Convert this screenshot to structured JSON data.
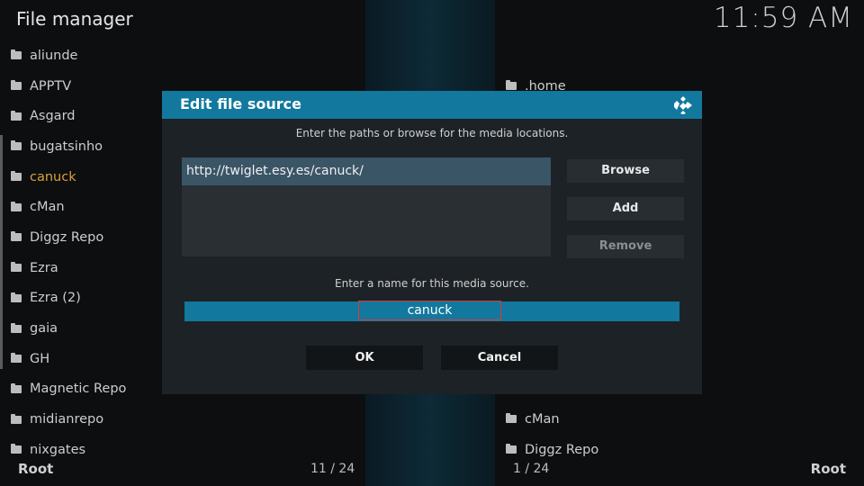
{
  "header": {
    "title": "File manager",
    "clock": "11:59 AM"
  },
  "left_list": [
    {
      "label": "aliunde"
    },
    {
      "label": "APPTV"
    },
    {
      "label": "Asgard"
    },
    {
      "label": "bugatsinho"
    },
    {
      "label": "canuck",
      "selected": true
    },
    {
      "label": "cMan"
    },
    {
      "label": "Diggz Repo"
    },
    {
      "label": "Ezra"
    },
    {
      "label": "Ezra (2)"
    },
    {
      "label": "gaia"
    },
    {
      "label": "GH"
    },
    {
      "label": "Magnetic Repo"
    },
    {
      "label": "midianrepo"
    },
    {
      "label": "nixgates"
    }
  ],
  "right_list": [
    {
      "label": ".home"
    },
    {
      "label": "cMan"
    },
    {
      "label": "Diggz Repo"
    }
  ],
  "footer": {
    "left_label": "Root",
    "left_count": "11 / 24",
    "right_count": "1 / 24",
    "right_label": "Root"
  },
  "dialog": {
    "title": "Edit file source",
    "instruction_paths": "Enter the paths or browse for the media locations.",
    "paths": [
      "http://twiglet.esy.es/canuck/"
    ],
    "browse_label": "Browse",
    "add_label": "Add",
    "remove_label": "Remove",
    "instruction_name": "Enter a name for this media source.",
    "name_value": "canuck",
    "ok_label": "OK",
    "cancel_label": "Cancel"
  },
  "colors": {
    "accent": "#12789e",
    "selected_text": "#d8a23b",
    "dialog_bg": "#1d2226",
    "name_field_border": "#d63b3b"
  },
  "icons": {
    "folder": "folder-icon",
    "dialog_logo": "kodi-logo-icon"
  }
}
